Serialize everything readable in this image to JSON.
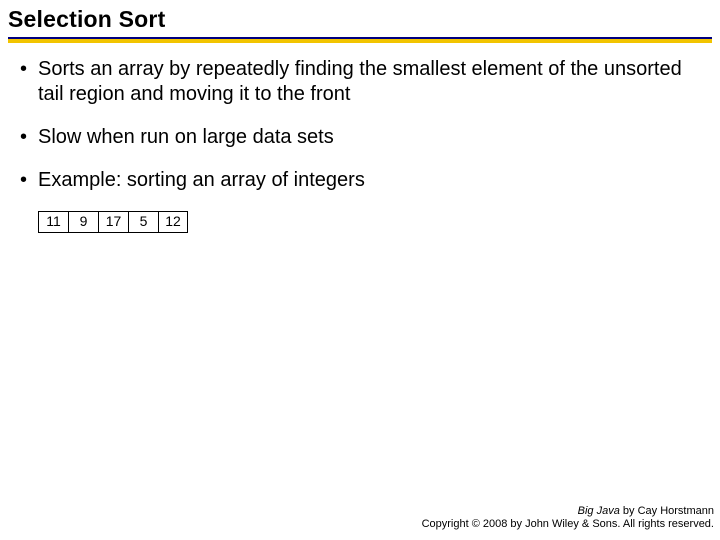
{
  "title": "Selection Sort",
  "bullets": {
    "b1": "Sorts an array by repeatedly finding the smallest element of the unsorted tail region and moving it to the front",
    "b2": "Slow when run on large data sets",
    "b3": "Example: sorting an array of integers"
  },
  "array": {
    "c0": "11",
    "c1": "9",
    "c2": "17",
    "c3": "5",
    "c4": "12"
  },
  "footer": {
    "book": "Big Java",
    "by": " by Cay Horstmann",
    "line2": "Copyright © 2008 by John Wiley & Sons.  All rights reserved."
  }
}
